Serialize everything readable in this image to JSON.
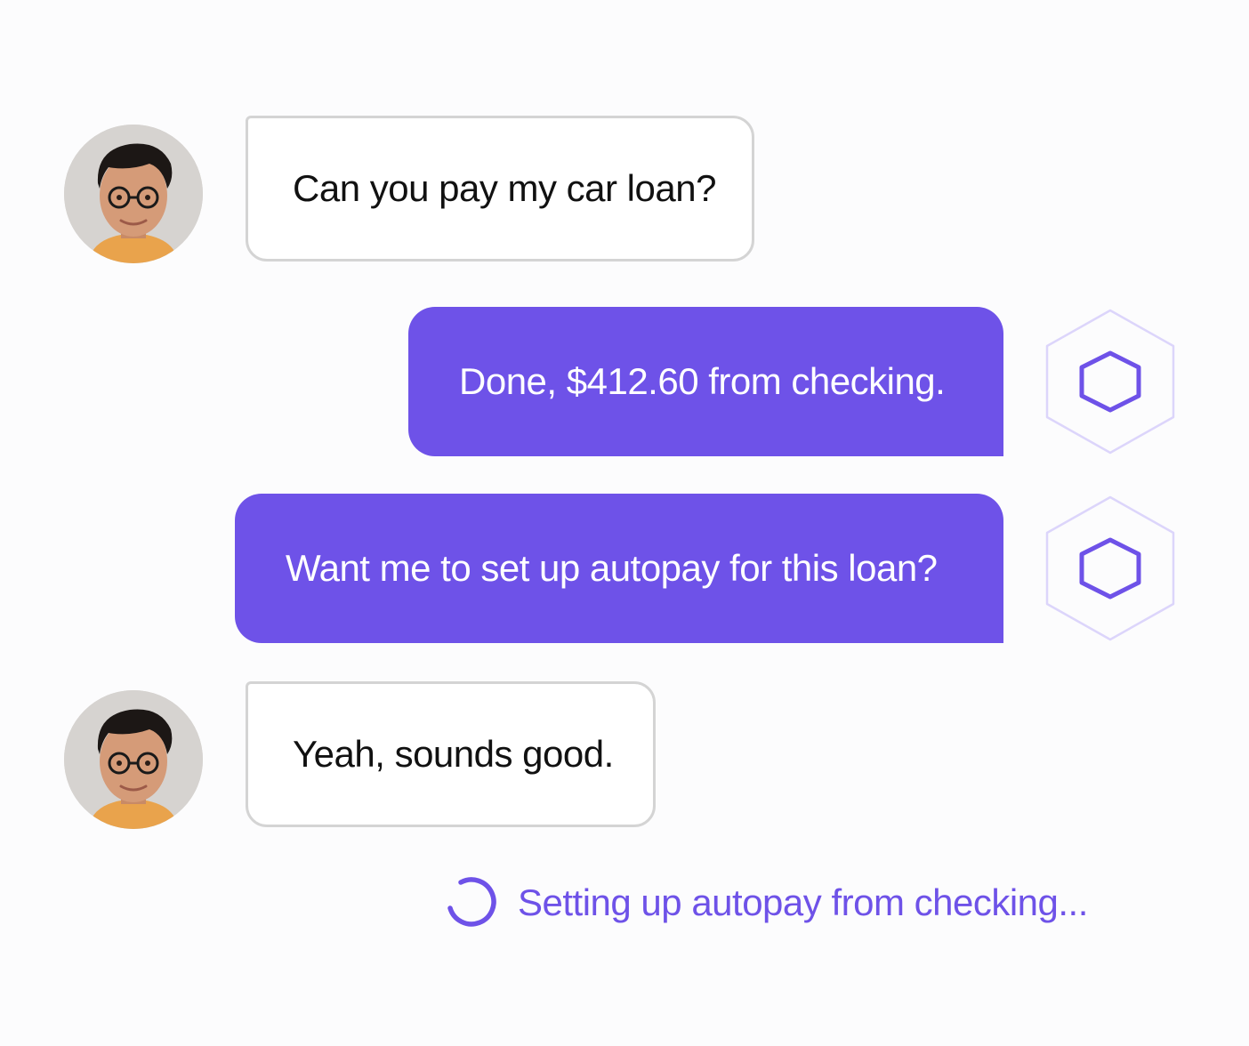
{
  "conversation": {
    "messages": [
      {
        "sender": "user",
        "text": "Can you pay my car loan?"
      },
      {
        "sender": "agent",
        "text": "Done, $412.60 from checking."
      },
      {
        "sender": "agent",
        "text": "Want me to set up autopay for this loan?"
      },
      {
        "sender": "user",
        "text": "Yeah, sounds good."
      }
    ],
    "status_text": "Setting up autopay from checking..."
  },
  "icons": {
    "user_avatar": "user-avatar-photo",
    "agent_avatar": "hexagon-icon",
    "status": "spinner-icon"
  },
  "colors": {
    "accent": "#6e52e8",
    "hex_outline_light": "#dcd5fb",
    "user_bubble_border": "#d4d4d4",
    "background": "#fcfcfd"
  }
}
